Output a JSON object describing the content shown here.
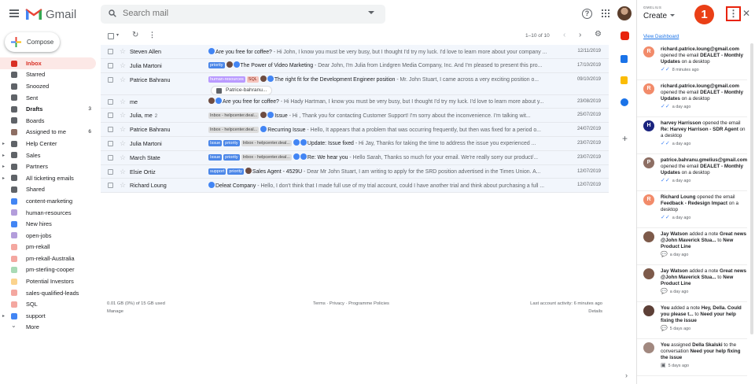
{
  "app": {
    "name": "Gmail"
  },
  "search": {
    "placeholder": "Search mail"
  },
  "compose": {
    "label": "Compose"
  },
  "nav": [
    {
      "label": "Inbox",
      "count": "",
      "color": "#d93025",
      "active": true,
      "bold": true
    },
    {
      "label": "Starred",
      "count": "",
      "color": "#5f6368"
    },
    {
      "label": "Snoozed",
      "count": "",
      "color": "#5f6368"
    },
    {
      "label": "Sent",
      "count": "",
      "color": "#5f6368"
    },
    {
      "label": "Drafts",
      "count": "3",
      "color": "#5f6368",
      "bold": true
    },
    {
      "label": "Boards",
      "count": "",
      "color": "#5f6368"
    },
    {
      "label": "Assigned to me",
      "count": "6",
      "color": "#8d6e63"
    },
    {
      "label": "Help Center",
      "count": "",
      "color": "#5f6368",
      "expand": true
    },
    {
      "label": "Sales",
      "count": "",
      "color": "#5f6368",
      "expand": true
    },
    {
      "label": "Partners",
      "count": "",
      "color": "#5f6368",
      "expand": true
    },
    {
      "label": "All ticketing emails",
      "count": "",
      "color": "#5f6368",
      "expand": true
    },
    {
      "label": "Shared",
      "count": "",
      "color": "#5f6368"
    },
    {
      "label": "content-marketing",
      "count": "",
      "color": "#4285f4"
    },
    {
      "label": "human-resources",
      "count": "",
      "color": "#b39ddb"
    },
    {
      "label": "New hires",
      "count": "",
      "color": "#4285f4"
    },
    {
      "label": "open-jobs",
      "count": "",
      "color": "#b39ddb"
    },
    {
      "label": "pm-rekall",
      "count": "",
      "color": "#f4a7a0"
    },
    {
      "label": "pm-rekall-Australia",
      "count": "",
      "color": "#f4a7a0"
    },
    {
      "label": "pm-sterling-cooper",
      "count": "",
      "color": "#a8dab5"
    },
    {
      "label": "Potential Investors",
      "count": "",
      "color": "#fbd38d"
    },
    {
      "label": "sales-qualified-leads",
      "count": "",
      "color": "#f4a7a0"
    },
    {
      "label": "SQL",
      "count": "",
      "color": "#f4a7a0"
    },
    {
      "label": "support",
      "count": "",
      "color": "#4285f4",
      "expand": true
    },
    {
      "label": "More",
      "count": "",
      "color": "#5f6368",
      "more": true
    }
  ],
  "toolbar": {
    "pager": "1–10 of 10"
  },
  "emails": [
    {
      "sender": "Steven Allen",
      "sender_count": "",
      "labels": [],
      "icons": [
        "#4285f4"
      ],
      "subject": "Are you free for coffee?",
      "snippet": " - Hi John, I know you must be very busy, but I thought I'd try my luck. I'd love to learn more about your company ...",
      "date": "12/11/2019"
    },
    {
      "sender": "Julia Martoni",
      "sender_count": "",
      "labels": [
        {
          "text": "priority",
          "bg": "#4a86e8",
          "fg": "#fff"
        }
      ],
      "icons": [
        "#6d4c41",
        "#4285f4"
      ],
      "subject": "The Power of Video Marketing",
      "snippet": " - Dear John, I'm Julia from Lindgren Media Company, Inc. And I'm pleased to present this pro...",
      "date": "17/10/2019"
    },
    {
      "sender": "Patrice Bahranu",
      "sender_count": "",
      "labels": [
        {
          "text": "human-resources",
          "bg": "#b99aff",
          "fg": "#fff"
        },
        {
          "text": "SQL",
          "bg": "#f6c5be",
          "fg": "#822111"
        }
      ],
      "icons": [
        "#6d4c41",
        "#4285f4"
      ],
      "subject": "The right fit for the Development Engineer position",
      "snippet": " - Mr. John Stuart, I came across a very exciting position o...",
      "date": "09/10/2019",
      "attachment": "Patrice-bahranu..."
    },
    {
      "sender": "me",
      "sender_count": "",
      "labels": [],
      "icons": [
        "#6d4c41",
        "#4285f4"
      ],
      "subject": "Are you free for coffee?",
      "snippet": " - Hi Hady Hartman, I know you must be very busy, but I thought I'd try my luck. I'd love to learn more about y...",
      "date": "23/08/2019"
    },
    {
      "sender": "Julia, me",
      "sender_count": "2",
      "labels": [
        {
          "text": "Inbox - helpcenter.deal...",
          "bg": "#dddddd",
          "fg": "#444"
        }
      ],
      "icons": [
        "#6d4c41",
        "#4285f4"
      ],
      "subject": "Issue",
      "snippet": " - Hi , Thank you for contacting Customer Support! I'm sorry about the inconvenience. I'm talking wit...",
      "date": "25/07/2019"
    },
    {
      "sender": "Patrice Bahranu",
      "sender_count": "",
      "labels": [
        {
          "text": "Inbox - helpcenter.deal...",
          "bg": "#dddddd",
          "fg": "#444"
        }
      ],
      "icons": [
        "#4285f4"
      ],
      "subject": "Recurring Issue",
      "snippet": " - Hello, It appears that a problem that was occurring frequently, but then was fixed for a period o...",
      "date": "24/07/2019"
    },
    {
      "sender": "Julia Martoni",
      "sender_count": "",
      "labels": [
        {
          "text": "Issue",
          "bg": "#4a86e8",
          "fg": "#fff"
        },
        {
          "text": "priority",
          "bg": "#4a86e8",
          "fg": "#fff"
        },
        {
          "text": "Inbox - helpcenter.deal...",
          "bg": "#dddddd",
          "fg": "#444"
        }
      ],
      "icons": [
        "#4285f4",
        "#4285f4"
      ],
      "subject": "Update: Issue fixed",
      "snippet": " - Hi Jay, Thanks for taking the time to address the issue you experienced ...",
      "date": "23/07/2019"
    },
    {
      "sender": "March State",
      "sender_count": "",
      "labels": [
        {
          "text": "Issue",
          "bg": "#4a86e8",
          "fg": "#fff"
        },
        {
          "text": "priority",
          "bg": "#4a86e8",
          "fg": "#fff"
        },
        {
          "text": "Inbox - helpcenter.deal...",
          "bg": "#dddddd",
          "fg": "#444"
        }
      ],
      "icons": [
        "#4285f4",
        "#4285f4"
      ],
      "subject": "Re: We hear you",
      "snippet": " - Hello Sarah, Thanks so much for your email. We're really sorry our product/...",
      "date": "23/07/2019"
    },
    {
      "sender": "Elsie Ortiz",
      "sender_count": "",
      "labels": [
        {
          "text": "support",
          "bg": "#4a86e8",
          "fg": "#fff"
        },
        {
          "text": "priority",
          "bg": "#4a86e8",
          "fg": "#fff"
        }
      ],
      "icons": [
        "#6d4c41"
      ],
      "subject": "Sales Agent - 4529U",
      "snippet": " - Dear Mr John Stuart, I am writing to apply for the SRD position advertised in the Times Union. A...",
      "date": "12/07/2019"
    },
    {
      "sender": "Richard Loung",
      "sender_count": "",
      "labels": [],
      "icons": [
        "#4285f4"
      ],
      "subject": "Deleat Company",
      "snippet": " - Hello, I don't think that I made full use of my trial account, could I have another trial and think about purchasing a full ...",
      "date": "12/07/2019"
    }
  ],
  "footer": {
    "storage": "0.01 GB (0%) of 15 GB used",
    "manage": "Manage",
    "policies": "Terms · Privacy · Programme Policies",
    "activity": "Last account activity: 6 minutes ago",
    "details": "Details"
  },
  "panel": {
    "brand": "GMELIUS",
    "create": "Create",
    "step_badge": "1",
    "dashboard_link": "View Dashboard",
    "notifications": [
      {
        "initial": "R",
        "color": "#f28b6a",
        "parts": [
          {
            "t": "richard.patrice.loung@gmail.com",
            "b": true
          },
          {
            "t": " opened the email ",
            "b": false
          },
          {
            "t": "DEALET - Monthly Updates",
            "b": true
          },
          {
            "t": " on a desktop",
            "b": false
          }
        ],
        "time": "8 minutes ago",
        "dot": true
      },
      {
        "initial": "R",
        "color": "#f28b6a",
        "parts": [
          {
            "t": "richard.patrice.loung@gmail.com",
            "b": true
          },
          {
            "t": " opened the email ",
            "b": false
          },
          {
            "t": "DEALET - Monthly Updates",
            "b": true
          },
          {
            "t": " on a desktop",
            "b": false
          }
        ],
        "time": "a day ago"
      },
      {
        "initial": "H",
        "color": "#1a237e",
        "parts": [
          {
            "t": "harvey Harrisson",
            "b": true
          },
          {
            "t": " opened the email ",
            "b": false
          },
          {
            "t": "Re: Harvey Harrison - SDR Agent",
            "b": true
          },
          {
            "t": " on a desktop",
            "b": false
          }
        ],
        "time": "a day ago"
      },
      {
        "initial": "P",
        "color": "#8d6e63",
        "parts": [
          {
            "t": "patrice.bahranu.gmelius@gmail.com",
            "b": true
          },
          {
            "t": " opened the email ",
            "b": false
          },
          {
            "t": "DEALET - Monthly Updates",
            "b": true
          },
          {
            "t": " on a desktop",
            "b": false
          }
        ],
        "time": "a day ago"
      },
      {
        "initial": "R",
        "color": "#f28b6a",
        "parts": [
          {
            "t": "Richard Loung",
            "b": true
          },
          {
            "t": " opened the email ",
            "b": false
          },
          {
            "t": "Feedback - Redesign Impact",
            "b": true
          },
          {
            "t": " on a desktop",
            "b": false
          }
        ],
        "time": "a day ago"
      },
      {
        "initial": "",
        "color": "#7d5a4a",
        "parts": [
          {
            "t": "Jay Watson",
            "b": true
          },
          {
            "t": " added a note ",
            "b": false
          },
          {
            "t": "Great news @John Maverick Stua...",
            "b": true
          },
          {
            "t": " to ",
            "b": false
          },
          {
            "t": "New Product Line",
            "b": true
          }
        ],
        "time": "a day ago",
        "note": true
      },
      {
        "initial": "",
        "color": "#7d5a4a",
        "parts": [
          {
            "t": "Jay Watson",
            "b": true
          },
          {
            "t": " added a note ",
            "b": false
          },
          {
            "t": "Great news @John Maverick Stua...",
            "b": true
          },
          {
            "t": " to ",
            "b": false
          },
          {
            "t": "New Product Line",
            "b": true
          }
        ],
        "time": "a day ago",
        "note": true
      },
      {
        "initial": "",
        "color": "#5d4037",
        "parts": [
          {
            "t": "You",
            "b": true
          },
          {
            "t": " added a note ",
            "b": false
          },
          {
            "t": "Hey, Della. Could you please t...",
            "b": true
          },
          {
            "t": " to ",
            "b": false
          },
          {
            "t": "Need your help fixing the issue",
            "b": true
          }
        ],
        "time": "5 days ago",
        "note": true
      },
      {
        "initial": "",
        "color": "#a1887f",
        "parts": [
          {
            "t": "You",
            "b": true
          },
          {
            "t": " assigned ",
            "b": false
          },
          {
            "t": "Della Skalski",
            "b": true
          },
          {
            "t": " to the conversation ",
            "b": false
          },
          {
            "t": "Need your help fixing the issue",
            "b": true
          }
        ],
        "time": "5 days ago",
        "assign": true
      }
    ]
  }
}
